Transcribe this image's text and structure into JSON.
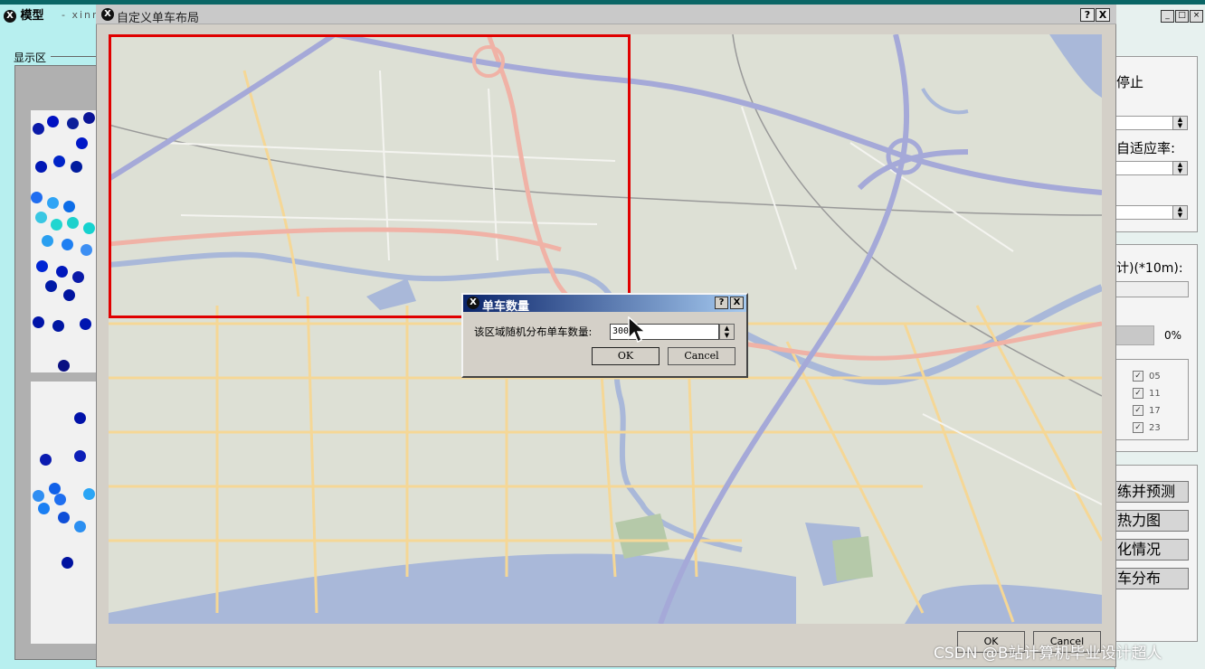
{
  "background_app": {
    "title": "模型",
    "title_suffix": "- xinro",
    "display_area_label": "显示区",
    "right_panel": {
      "stop_label": "停止",
      "adapt_rate_label": "自适应率:",
      "distance_label": "计)(*10m):",
      "progress_text": "0%",
      "checkboxes": [
        "05",
        "11",
        "17",
        "23"
      ],
      "buttons": [
        "练并预测",
        "热力图",
        "化情况",
        "车分布"
      ]
    }
  },
  "custom_layout_dialog": {
    "title": "自定义单车布局",
    "help_btn": "?",
    "close_btn": "X",
    "ok_label": "OK",
    "cancel_label": "Cancel"
  },
  "bike_count_dialog": {
    "title": "单车数量",
    "help_btn": "?",
    "close_btn": "X",
    "prompt": "该区域随机分布单车数量:",
    "value": "300",
    "ok_label": "OK",
    "cancel_label": "Cancel"
  },
  "watermark": "CSDN @B站计算机毕业设计超人",
  "colors": {
    "selection_rect": "#e00000",
    "title_gradient_start": "#0a246a",
    "map_bg": "#dde0d5",
    "map_water": "#a9b8d9",
    "map_expressway": "#a5a9d8",
    "map_highway": "#f0b2a6",
    "map_road": "#f5d796"
  }
}
